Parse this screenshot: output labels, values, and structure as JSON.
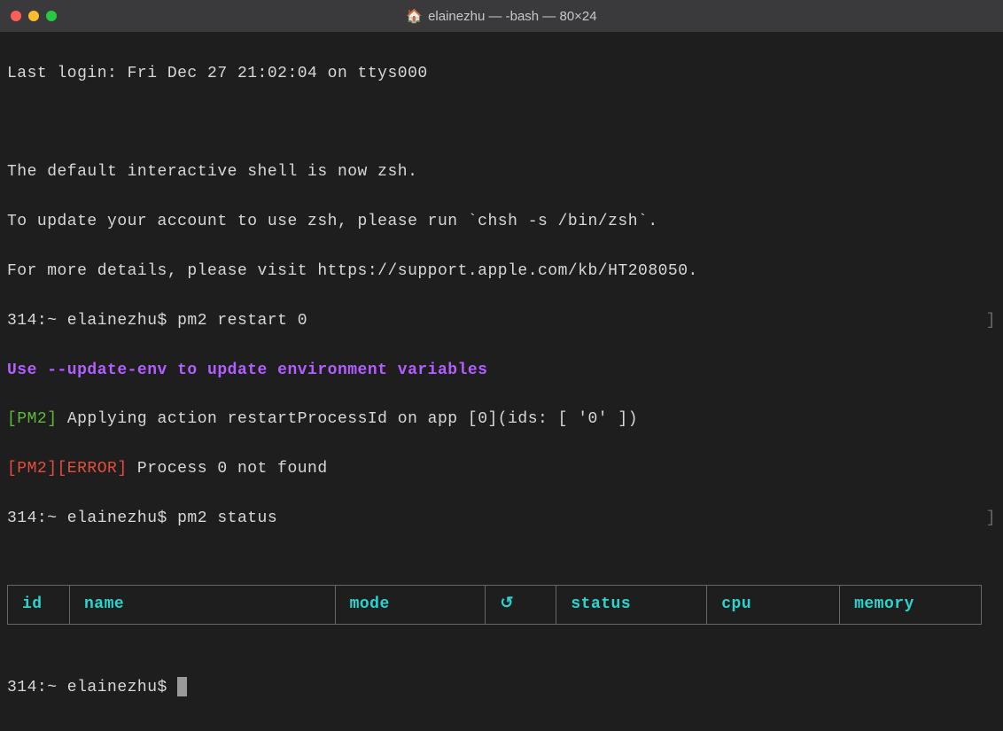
{
  "window": {
    "title": "elainezhu — -bash — 80×24"
  },
  "lines": {
    "last_login": "Last login: Fri Dec 27 21:02:04 on ttys000",
    "zsh_notice_1": "The default interactive shell is now zsh.",
    "zsh_notice_2": "To update your account to use zsh, please run `chsh -s /bin/zsh`.",
    "zsh_notice_3": "For more details, please visit https://support.apple.com/kb/HT208050.",
    "prompt_1_left": "314:~ elainezhu$ pm2 restart 0",
    "prompt_1_right": "]",
    "env_hint": "Use --update-env to update environment variables",
    "pm2_prefix_green": "[PM2]",
    "pm2_action_text": " Applying action restartProcessId on app [0](ids: [ '0' ])",
    "pm2_error_prefix": "[PM2][ERROR]",
    "pm2_error_text": " Process 0 not found",
    "prompt_2_left": "314:~ elainezhu$ pm2 status",
    "prompt_2_right": "]",
    "prompt_3": "314:~ elainezhu$ "
  },
  "table_headers": {
    "id": "id",
    "name": "name",
    "mode": "mode",
    "reload": "↺",
    "status": "status",
    "cpu": "cpu",
    "memory": "memory"
  }
}
